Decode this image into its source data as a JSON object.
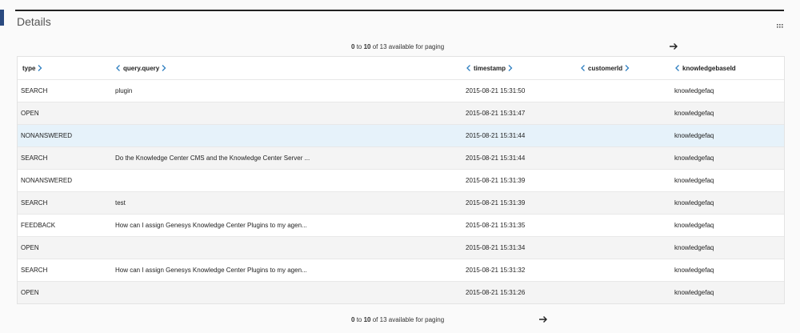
{
  "panel": {
    "title": "Details"
  },
  "pager": {
    "from": "0",
    "to_word": "to",
    "to": "10",
    "of_word": "of",
    "total": "13",
    "suffix": "available for paging"
  },
  "columns": {
    "type": "type",
    "query": "query.query",
    "timestamp": "timestamp",
    "customer": "customerId",
    "kb": "knowledgebaseId"
  },
  "rows": [
    {
      "type": "SEARCH",
      "query": "plugin",
      "timestamp": "2015-08-21 15:31:50",
      "customer": "",
      "kb": "knowledgefaq"
    },
    {
      "type": "OPEN",
      "query": "",
      "timestamp": "2015-08-21 15:31:47",
      "customer": "",
      "kb": "knowledgefaq"
    },
    {
      "type": "NONANSWERED",
      "query": "",
      "timestamp": "2015-08-21 15:31:44",
      "customer": "",
      "kb": "knowledgefaq"
    },
    {
      "type": "SEARCH",
      "query": "Do the Knowledge Center CMS and the Knowledge Center Server ...",
      "timestamp": "2015-08-21 15:31:44",
      "customer": "",
      "kb": "knowledgefaq"
    },
    {
      "type": "NONANSWERED",
      "query": "",
      "timestamp": "2015-08-21 15:31:39",
      "customer": "",
      "kb": "knowledgefaq"
    },
    {
      "type": "SEARCH",
      "query": "test",
      "timestamp": "2015-08-21 15:31:39",
      "customer": "",
      "kb": "knowledgefaq"
    },
    {
      "type": "FEEDBACK",
      "query": "How can I assign Genesys Knowledge Center Plugins to my agen...",
      "timestamp": "2015-08-21 15:31:35",
      "customer": "",
      "kb": "knowledgefaq"
    },
    {
      "type": "OPEN",
      "query": "",
      "timestamp": "2015-08-21 15:31:34",
      "customer": "",
      "kb": "knowledgefaq"
    },
    {
      "type": "SEARCH",
      "query": "How can I assign Genesys Knowledge Center Plugins to my agen...",
      "timestamp": "2015-08-21 15:31:32",
      "customer": "",
      "kb": "knowledgefaq"
    },
    {
      "type": "OPEN",
      "query": "",
      "timestamp": "2015-08-21 15:31:26",
      "customer": "",
      "kb": "knowledgefaq"
    }
  ],
  "icons": {
    "sort_left": "chevron-left-icon",
    "sort_right": "chevron-right-icon",
    "next": "arrow-right-icon",
    "menu": "grid-dots-icon"
  },
  "colors": {
    "accent": "#2a4a7f",
    "chevron": "#2f7fc1",
    "selected_row": "#e6f2fa",
    "alt_row": "#f4f4f4"
  },
  "selected_row_index": 2
}
